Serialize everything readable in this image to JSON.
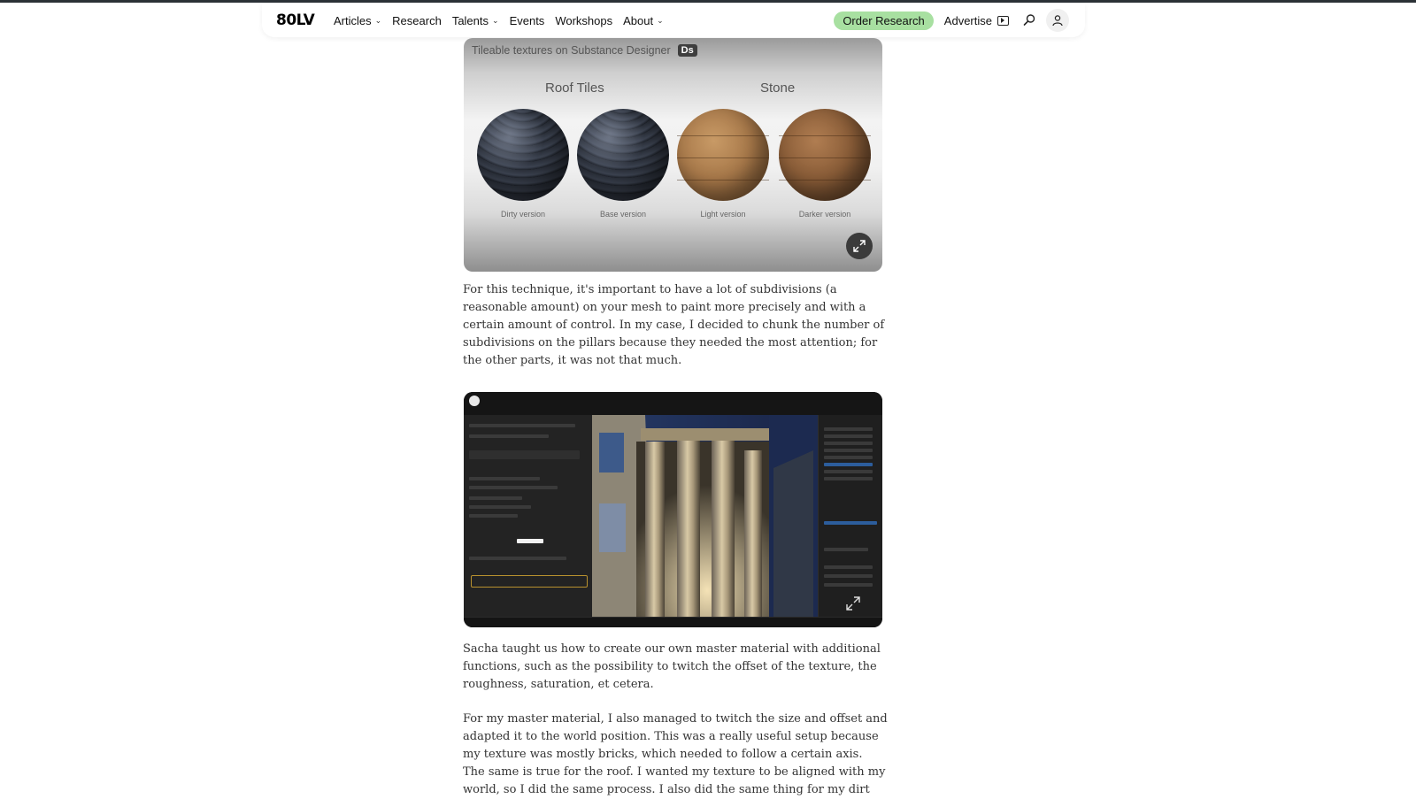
{
  "nav": {
    "logo": "80LV",
    "items": [
      {
        "label": "Articles",
        "dropdown": true
      },
      {
        "label": "Research",
        "dropdown": false
      },
      {
        "label": "Talents",
        "dropdown": true
      },
      {
        "label": "Events",
        "dropdown": false
      },
      {
        "label": "Workshops",
        "dropdown": false
      },
      {
        "label": "About",
        "dropdown": true
      }
    ],
    "order_research": "Order Research",
    "advertise": "Advertise",
    "icons": {
      "advertise": "play-icon",
      "search": "search-icon",
      "user": "user-icon"
    },
    "accent_color": "#a8e0a1"
  },
  "figure1": {
    "caption": "Tileable textures on Substance Designer",
    "badge": "Ds",
    "groups": [
      "Roof Tiles",
      "Stone"
    ],
    "spheres": [
      {
        "label": "Dirty version",
        "material": "roof"
      },
      {
        "label": "Base version",
        "material": "roof"
      },
      {
        "label": "Light version",
        "material": "stone"
      },
      {
        "label": "Darker version",
        "material": "stone-dark"
      }
    ]
  },
  "paragraphs": [
    "For this technique, it's important to have a lot of subdivisions (a reasonable amount) on your mesh to paint more precisely and with a certain amount of control. In my case, I decided to chunk the number of subdivisions on the pillars because they needed the most attention; for the other parts, it was not that much.",
    "Sacha taught us how to create our own master material with additional functions, such as the possibility to twitch the offset of the texture, the roughness, saturation, et cetera.",
    "For my master material, I also managed to twitch the size and offset and adapted it to the world position. This was a really useful setup because my texture was mostly bricks, which needed to follow a certain axis. The same is true for the roof. I wanted my texture to be aligned with my world, so I did the same process. I also did the same thing for my dirt"
  ],
  "figure2": {
    "description_icon": "unreal-editor-screenshot"
  }
}
